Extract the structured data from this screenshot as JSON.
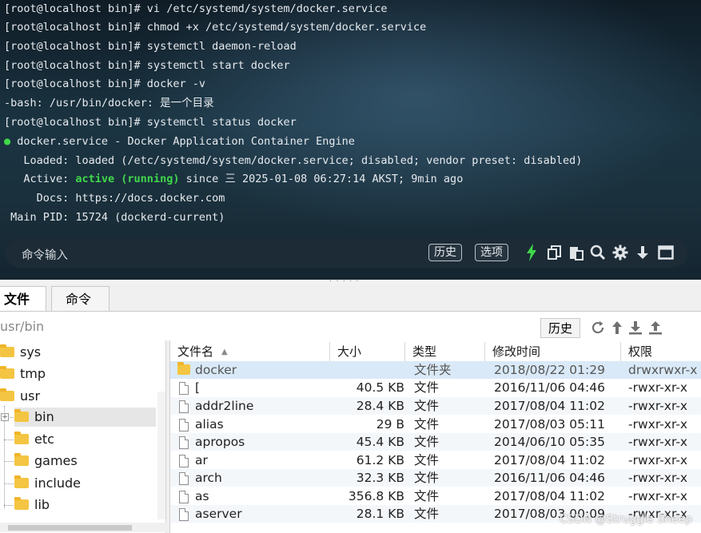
{
  "terminal": {
    "lines": [
      "[root@localhost bin]# vi /etc/systemd/system/docker.service",
      "[root@localhost bin]# chmod +x /etc/systemd/system/docker.service",
      "[root@localhost bin]# systemctl daemon-reload",
      "[root@localhost bin]# systemctl start docker",
      "[root@localhost bin]# docker -v",
      "-bash: /usr/bin/docker: 是一个目录",
      "[root@localhost bin]# systemctl status docker"
    ],
    "status_bullet": "●",
    "status_title": " docker.service - Docker Application Container Engine",
    "loaded_line": "   Loaded: loaded (/etc/systemd/system/docker.service; disabled; vendor preset: disabled)",
    "active_prefix": "   Active: ",
    "active_state": "active (running)",
    "active_suffix": " since 三 2025-01-08 06:27:14 AKST; 9min ago",
    "docs_line": "     Docs: https://docs.docker.com",
    "mainpid_line": " Main PID: 15724 (dockerd-current)",
    "command_placeholder": "命令输入",
    "history_button": "历史",
    "options_button": "选项",
    "accent_green": "#3fd84a",
    "toolbar_icons": [
      "lightning-icon",
      "copy-icon",
      "paste-icon",
      "search-icon",
      "gear-icon",
      "down-arrow-icon",
      "maximize-icon"
    ]
  },
  "tabs": {
    "files_label": "文件",
    "commands_label": "命令"
  },
  "pathbar": {
    "path": "usr/bin",
    "history_button": "历史",
    "icons": [
      "refresh-icon",
      "up-icon",
      "download-icon",
      "upload-icon"
    ]
  },
  "tree": {
    "items": [
      {
        "label": "sys"
      },
      {
        "label": "tmp"
      },
      {
        "label": "usr"
      },
      {
        "label": "bin"
      },
      {
        "label": "etc"
      },
      {
        "label": "games"
      },
      {
        "label": "include"
      },
      {
        "label": "lib"
      }
    ]
  },
  "files": {
    "columns": [
      "文件名",
      "大小",
      "类型",
      "修改时间",
      "权限"
    ],
    "rows": [
      {
        "name": "docker",
        "size": "",
        "type": "文件夹",
        "mtime": "2018/08/22 01:29",
        "perm": "drwxrwxr-x"
      },
      {
        "name": "[",
        "size": "40.5 KB",
        "type": "文件",
        "mtime": "2016/11/06 04:46",
        "perm": "-rwxr-xr-x"
      },
      {
        "name": "addr2line",
        "size": "28.4 KB",
        "type": "文件",
        "mtime": "2017/08/04 11:02",
        "perm": "-rwxr-xr-x"
      },
      {
        "name": "alias",
        "size": "29 B",
        "type": "文件",
        "mtime": "2017/08/03 05:11",
        "perm": "-rwxr-xr-x"
      },
      {
        "name": "apropos",
        "size": "45.4 KB",
        "type": "文件",
        "mtime": "2014/06/10 05:35",
        "perm": "-rwxr-xr-x"
      },
      {
        "name": "ar",
        "size": "61.2 KB",
        "type": "文件",
        "mtime": "2017/08/04 11:02",
        "perm": "-rwxr-xr-x"
      },
      {
        "name": "arch",
        "size": "32.3 KB",
        "type": "文件",
        "mtime": "2016/11/06 04:46",
        "perm": "-rwxr-xr-x"
      },
      {
        "name": "as",
        "size": "356.8 KB",
        "type": "文件",
        "mtime": "2017/08/04 11:02",
        "perm": "-rwxr-xr-x"
      },
      {
        "name": "aserver",
        "size": "28.1 KB",
        "type": "文件",
        "mtime": "2017/08/03 00:09",
        "perm": "-rwxr-xr-x"
      }
    ]
  },
  "watermark": "CSDN @Struggle Sheep"
}
